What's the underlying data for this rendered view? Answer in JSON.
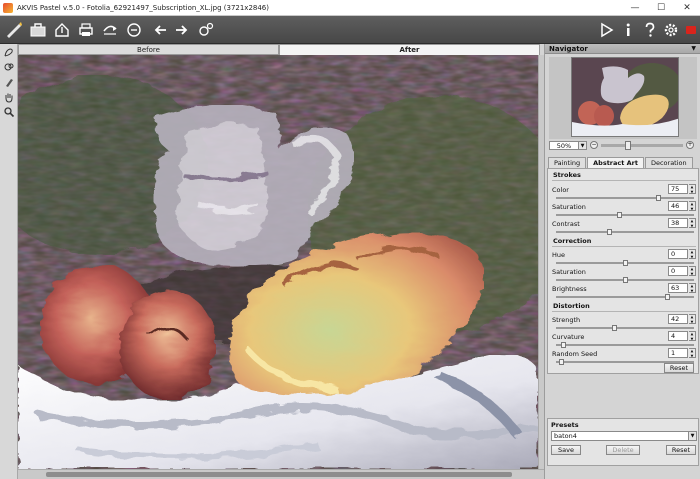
{
  "window": {
    "title": "AKVIS Pastel v.5.0 - Fotolia_62921497_Subscription_XL.jpg (3721x2846)",
    "minimize": "—",
    "maximize": "☐",
    "close": "✕"
  },
  "toolbar": {
    "left_icons": [
      "akvis-logo-icon",
      "open-icon",
      "save-icon",
      "print-icon",
      "share-icon",
      "undo-icon",
      "redo-icon",
      "batch-icon"
    ],
    "right_icons": [
      "run-icon",
      "info-icon",
      "help-icon",
      "settings-icon",
      "record-icon"
    ]
  },
  "tools": [
    "pencil-icon",
    "eraser-icon",
    "brush-icon",
    "hand-icon",
    "zoom-icon"
  ],
  "view_tabs": {
    "before": "Before",
    "after": "After"
  },
  "navigator": {
    "title": "Navigator",
    "zoom": "50%",
    "zoom_minus": "−",
    "zoom_plus": "+"
  },
  "panel_tabs": {
    "painting": "Painting",
    "abstract_art": "Abstract Art",
    "decoration": "Decoration"
  },
  "strokes": {
    "title": "Strokes",
    "params": [
      {
        "label": "Color",
        "value": "75",
        "level": 0.75
      },
      {
        "label": "Saturation",
        "value": "46",
        "level": 0.46
      },
      {
        "label": "Contrast",
        "value": "38",
        "level": 0.38
      }
    ]
  },
  "correction": {
    "title": "Correction",
    "params": [
      {
        "label": "Hue",
        "value": "0",
        "level": 0.5
      },
      {
        "label": "Saturation",
        "value": "0",
        "level": 0.5
      },
      {
        "label": "Brightness",
        "value": "63",
        "level": 0.82
      }
    ]
  },
  "distortion": {
    "title": "Distortion",
    "params": [
      {
        "label": "Strength",
        "value": "42",
        "level": 0.42
      },
      {
        "label": "Curvature",
        "value": "4",
        "level": 0.04
      },
      {
        "label": "Random Seed",
        "value": "1",
        "level": 0.02
      }
    ]
  },
  "reset_label": "Reset",
  "presets": {
    "title": "Presets",
    "selected": "baton4",
    "save": "Save",
    "delete": "Delete",
    "reset": "Reset"
  },
  "colors": {
    "toolbar": "#4f4f4f",
    "accent": "#d9241c"
  }
}
